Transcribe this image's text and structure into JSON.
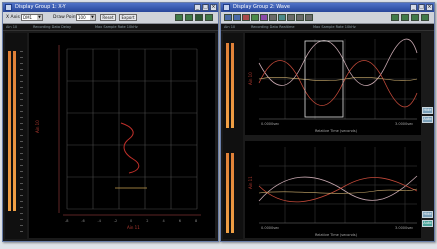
{
  "left_window": {
    "title": "Display Group 1: X-Y",
    "toolbar": {
      "x_axis_label": "X Axis",
      "x_axis_value": "DM1",
      "draw_points_label": "Draw Points",
      "draw_points_value": "100",
      "reset_label": "Reset",
      "export_label": "Export"
    },
    "status": {
      "channel": "Ain 10",
      "mode": "Recording Data Delay",
      "rate": "Max Sample Rate 10kHz"
    },
    "y_axis_label": "Ain 10",
    "x_axis_label": "Ain 11",
    "x_tick_labels": [
      "-8",
      "-6",
      "-4",
      "-2",
      "0",
      "2",
      "4",
      "6",
      "8"
    ],
    "curve_color": "#c0302a",
    "grid_color": "#555555"
  },
  "right_window": {
    "title": "Display Group 2: Wave",
    "status": {
      "channel": "Ain 10",
      "mode": "Recording Data Realtime",
      "rate": "Max Sample Rate 10kHz"
    },
    "top_plot": {
      "y_label": "Ain 10",
      "x_label": "Relative Time (seconds)",
      "x_start": "0.0000sec",
      "x_end": "3.0000sec"
    },
    "bottom_plot": {
      "y_label": "Ain 11",
      "x_label": "Relative Time (seconds)",
      "x_start": "0.0000sec",
      "x_end": "3.0000sec"
    },
    "side_buttons": [
      "Hide",
      "Auto",
      "Hide",
      "Auto"
    ],
    "trace_colors": [
      "#c8a8b0",
      "#c44a3a",
      "#d0b070"
    ]
  },
  "toolbar_icons": [
    "zoom-icon",
    "zoom-out-icon",
    "pan-icon",
    "cursor-icon",
    "marker-icon",
    "grid-icon",
    "fit-icon",
    "save-icon",
    "print-icon",
    "copy-icon"
  ]
}
